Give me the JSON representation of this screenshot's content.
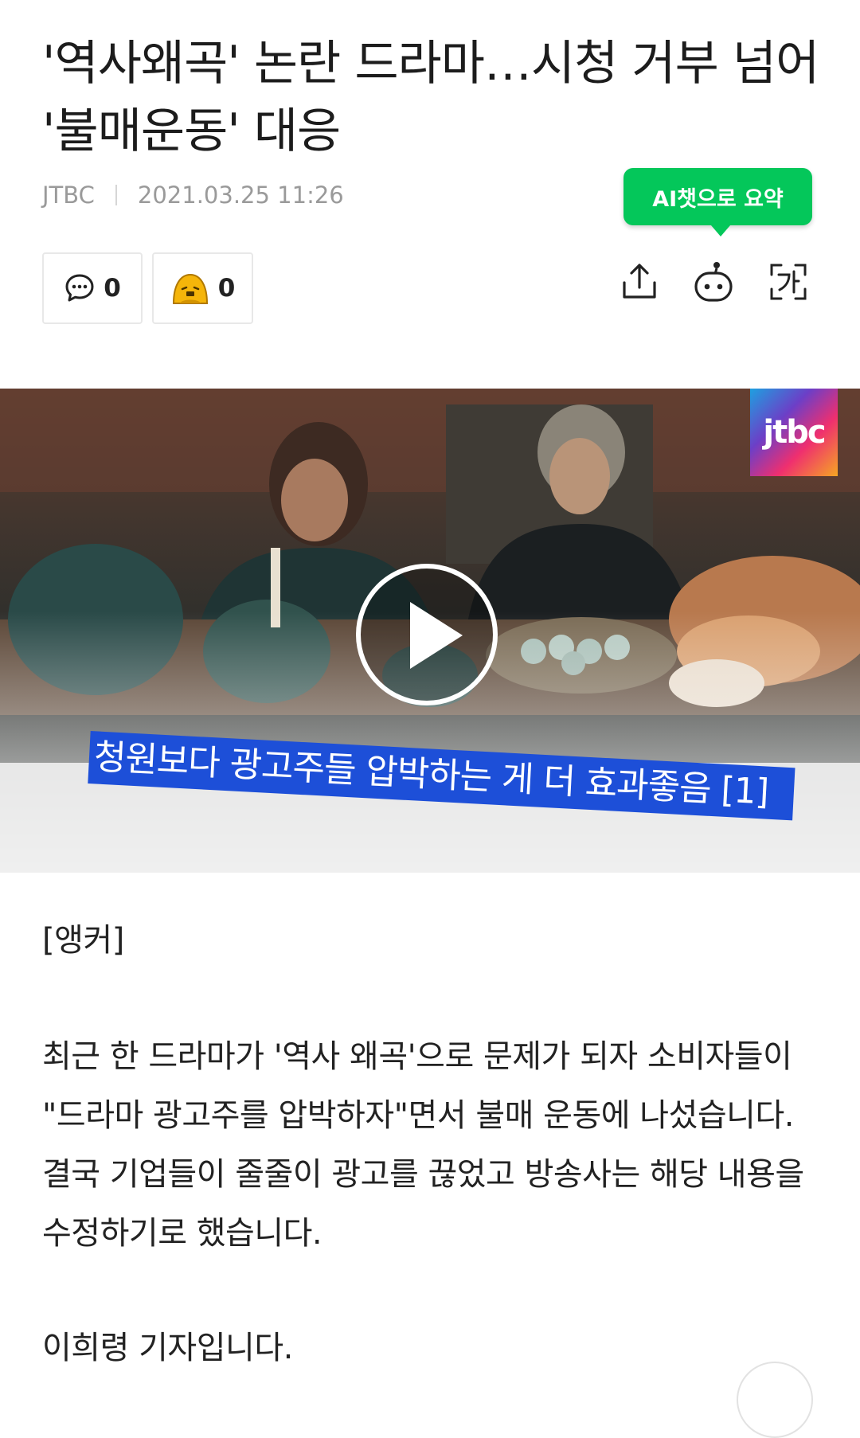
{
  "article": {
    "headline": "'역사왜곡' 논란 드라마…시청 거부 넘어 '불매운동' 대응",
    "source": "JTBC",
    "datetime": "2021.03.25 11:26"
  },
  "ai_summary": {
    "label": "AI챗으로 요약",
    "color": "#04c75a"
  },
  "counts": {
    "comments": "0",
    "reactions": "0"
  },
  "toolbar": {
    "icons": [
      "share-icon",
      "bot-icon",
      "font-size-icon"
    ]
  },
  "video": {
    "logo_text": "jtbc",
    "caption": "청원보다 광고주들 압박하는 게 더 효과좋음 [1]"
  },
  "body": {
    "anchor": "[앵커]",
    "paragraph": "최근 한 드라마가 '역사 왜곡'으로 문제가 되자 소비자들이 \"드라마 광고주를 압박하자\"면서 불매 운동에 나섰습니다. 결국 기업들이 줄줄이 광고를 끊었고 방송사는 해당 내용을 수정하기로 했습니다.",
    "reporter": "이희령 기자입니다."
  }
}
